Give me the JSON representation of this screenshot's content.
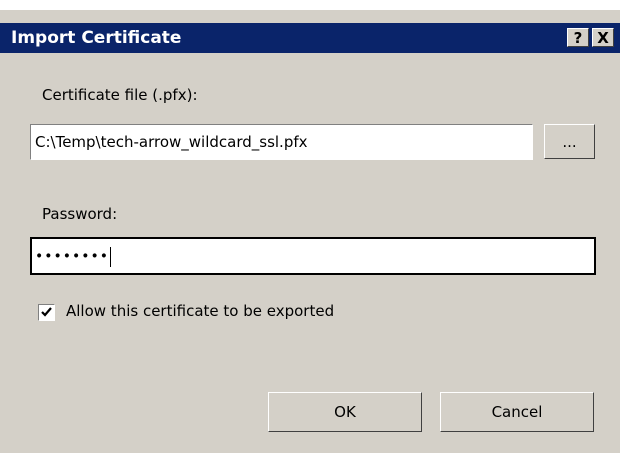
{
  "dialog": {
    "title": "Import Certificate",
    "help_label": "?",
    "close_label": "X"
  },
  "cert_file": {
    "label": "Certificate file (.pfx):",
    "value": "C:\\Temp\\tech-arrow_wildcard_ssl.pfx",
    "browse_label": "..."
  },
  "password": {
    "label": "Password:",
    "masked_value": "••••••••"
  },
  "allow_export": {
    "label": "Allow this certificate to be exported",
    "checked": true
  },
  "buttons": {
    "ok": "OK",
    "cancel": "Cancel"
  }
}
